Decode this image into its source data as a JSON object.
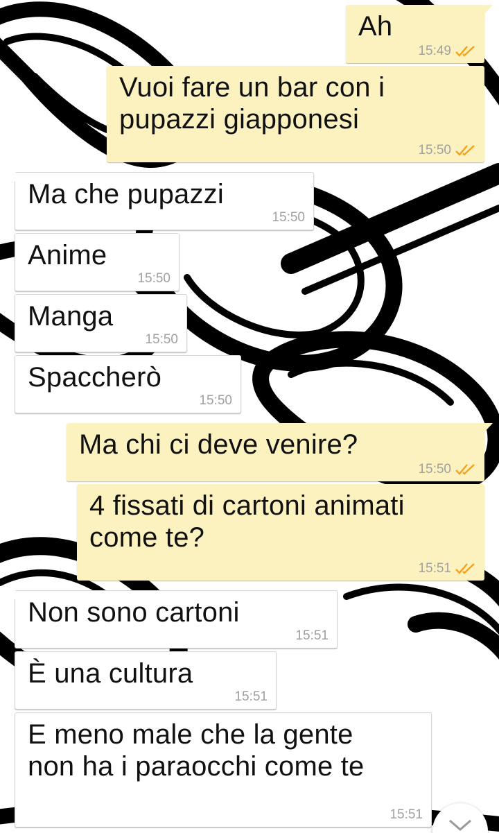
{
  "wallpaper": {
    "icon": "chain-links-doodle-icon"
  },
  "messages": [
    {
      "dir": "out",
      "text": "Ah",
      "time": "15:49",
      "status": "read"
    },
    {
      "dir": "out",
      "text": "Vuoi fare un bar con i\npupazzi giapponesi",
      "time": "15:50",
      "status": "read"
    },
    {
      "dir": "in",
      "text": "Ma che pupazzi",
      "time": "15:50"
    },
    {
      "dir": "in",
      "text": "Anime",
      "time": "15:50"
    },
    {
      "dir": "in",
      "text": "Manga",
      "time": "15:50"
    },
    {
      "dir": "in",
      "text": "Spaccherò",
      "time": "15:50"
    },
    {
      "dir": "out",
      "text": "Ma chi ci deve venire?",
      "time": "15:50",
      "status": "read"
    },
    {
      "dir": "out",
      "text": "4 fissati di cartoni animati\ncome te?",
      "time": "15:51",
      "status": "read"
    },
    {
      "dir": "in",
      "text": "Non sono cartoni",
      "time": "15:51"
    },
    {
      "dir": "in",
      "text": "È una cultura",
      "time": "15:51"
    },
    {
      "dir": "in",
      "text": "E meno male che la gente\nnon ha i paraocchi come te",
      "time": "15:51"
    }
  ],
  "colors": {
    "outgoing_bubble": "#fcf2c0",
    "incoming_bubble": "#ffffff",
    "read_check": "#f3a21d",
    "time_text": "#a0a0a0"
  },
  "scroll_button": {
    "icon": "chevron-down-icon"
  }
}
